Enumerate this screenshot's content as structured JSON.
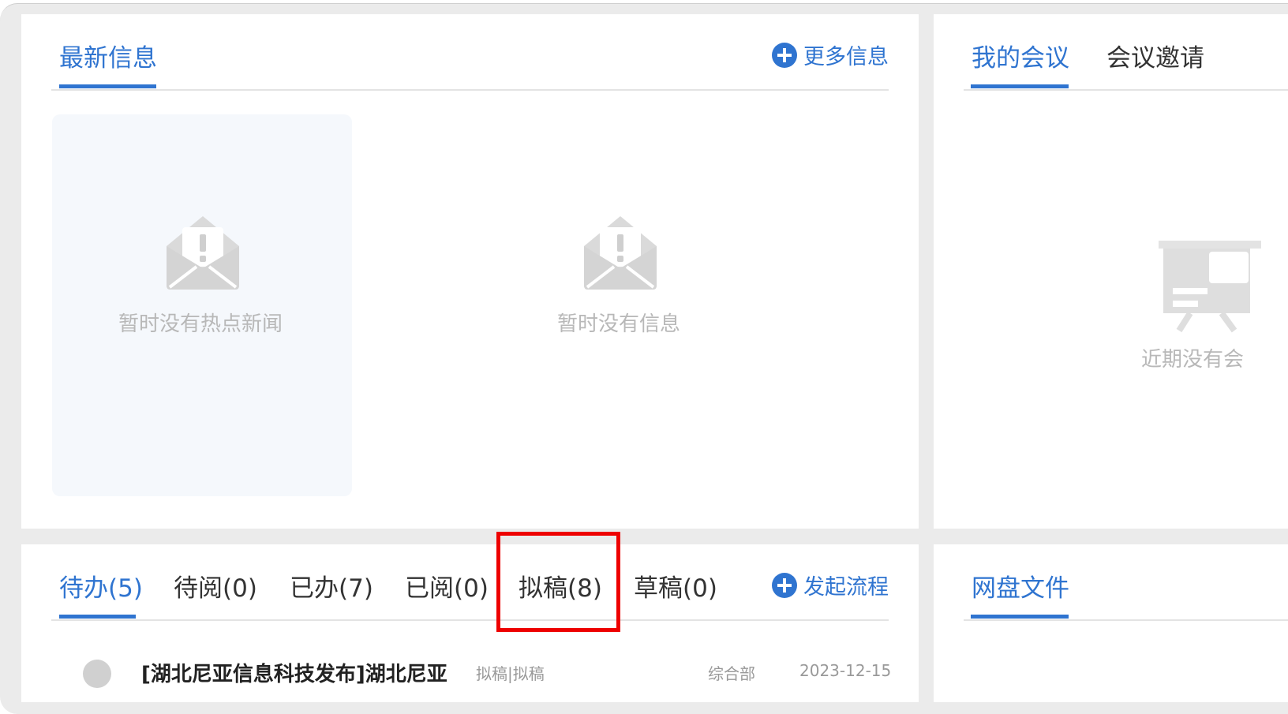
{
  "news_panel": {
    "tab_active": "最新信息",
    "more_link": "更多信息",
    "hot_news_empty": "暂时没有热点新闻",
    "info_empty": "暂时没有信息"
  },
  "meeting_panel": {
    "tabs": [
      "我的会议",
      "会议邀请"
    ],
    "empty_text": "近期没有会"
  },
  "workflow_panel": {
    "tabs": [
      "待办(5)",
      "待阅(0)",
      "已办(7)",
      "已阅(0)",
      "拟稿(8)",
      "草稿(0)"
    ],
    "start_link": "发起流程",
    "partial_row": {
      "title": "[湖北尼亚信息科技发布]湖北尼亚",
      "type": "拟稿|拟稿",
      "dept": "综合部",
      "date": "2023-12-15"
    }
  },
  "disk_panel": {
    "tab_active": "网盘文件"
  },
  "colors": {
    "accent": "#2f74d0",
    "highlight": "#ee0000",
    "muted": "#b8b8b8"
  }
}
